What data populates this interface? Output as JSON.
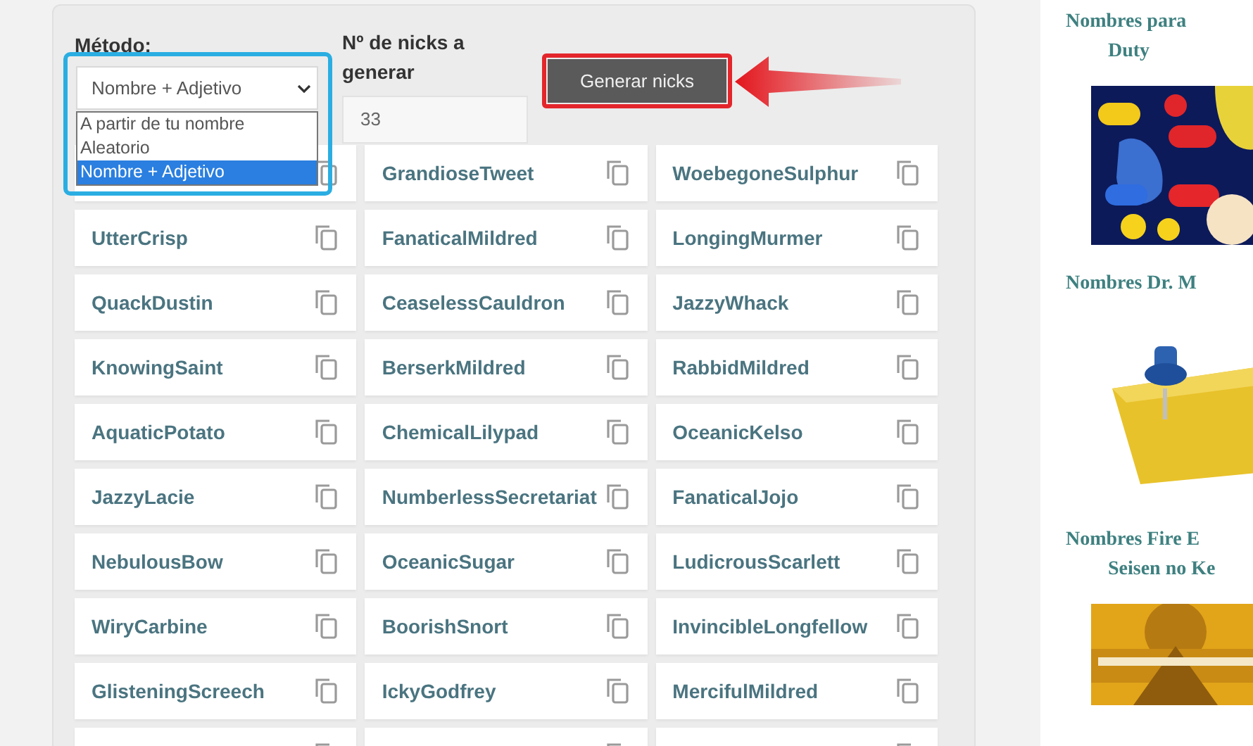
{
  "form": {
    "method_label": "Método:",
    "method_value": "Nombre + Adjetivo",
    "method_options": [
      {
        "label": "A partir de tu nombre",
        "selected": false
      },
      {
        "label": "Aleatorio",
        "selected": false
      },
      {
        "label": "Nombre + Adjetivo",
        "selected": true
      }
    ],
    "count_label": "Nº de nicks a generar",
    "count_value": "33",
    "button": "Generar nicks"
  },
  "nicks": [
    {
      "kind": "covered"
    },
    {
      "kind": "nick",
      "name": "GrandioseTweet"
    },
    {
      "kind": "nick",
      "name": "WoebegoneSulphur"
    },
    {
      "kind": "nick",
      "name": "UtterCrisp"
    },
    {
      "kind": "nick",
      "name": "FanaticalMildred"
    },
    {
      "kind": "nick",
      "name": "LongingMurmer"
    },
    {
      "kind": "nick",
      "name": "QuackDustin"
    },
    {
      "kind": "nick",
      "name": "CeaselessCauldron"
    },
    {
      "kind": "nick",
      "name": "JazzyWhack"
    },
    {
      "kind": "nick",
      "name": "KnowingSaint"
    },
    {
      "kind": "nick",
      "name": "BerserkMildred"
    },
    {
      "kind": "nick",
      "name": "RabbidMildred"
    },
    {
      "kind": "nick",
      "name": "AquaticPotato"
    },
    {
      "kind": "nick",
      "name": "ChemicalLilypad"
    },
    {
      "kind": "nick",
      "name": "OceanicKelso"
    },
    {
      "kind": "nick",
      "name": "JazzyLacie"
    },
    {
      "kind": "nick",
      "name": "NumberlessSecretariat"
    },
    {
      "kind": "nick",
      "name": "FanaticalJojo"
    },
    {
      "kind": "nick",
      "name": "NebulousBow"
    },
    {
      "kind": "nick",
      "name": "OceanicSugar"
    },
    {
      "kind": "nick",
      "name": "LudicrousScarlett"
    },
    {
      "kind": "nick",
      "name": "WiryCarbine"
    },
    {
      "kind": "nick",
      "name": "BoorishSnort"
    },
    {
      "kind": "nick",
      "name": "InvincibleLongfellow"
    },
    {
      "kind": "nick",
      "name": "GlisteningScreech"
    },
    {
      "kind": "nick",
      "name": "IckyGodfrey"
    },
    {
      "kind": "nick",
      "name": "MercifulMildred"
    },
    {
      "kind": "covered"
    },
    {
      "kind": "covered"
    },
    {
      "kind": "covered"
    }
  ],
  "sidebar": [
    {
      "kind": "title",
      "lines": [
        "Nombres para",
        "Duty"
      ]
    },
    {
      "kind": "picture"
    },
    {
      "kind": "title",
      "lines": [
        "Nombres Dr. M"
      ]
    },
    {
      "kind": "picture"
    },
    {
      "kind": "title",
      "lines": [
        "Nombres Fire E",
        "Seisen no Ke"
      ]
    },
    {
      "kind": "picture"
    }
  ]
}
